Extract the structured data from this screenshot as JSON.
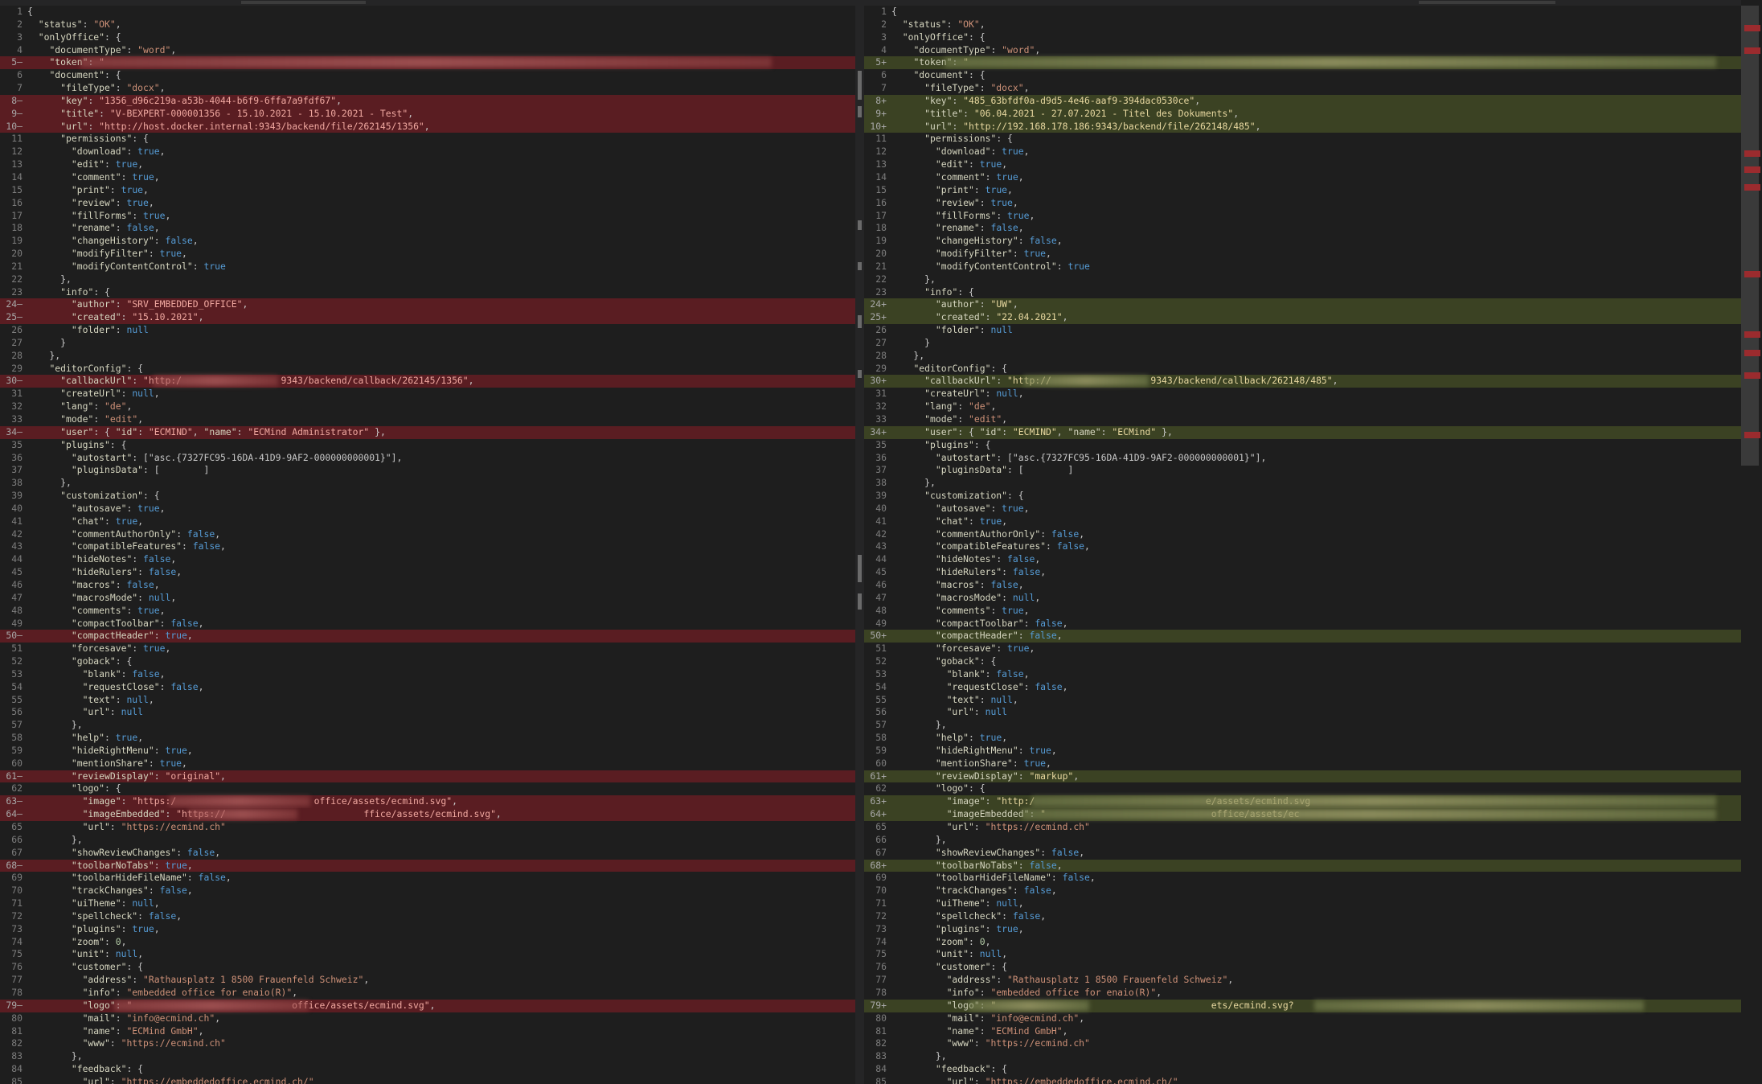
{
  "colors": {
    "removed_line": "#5a1d22",
    "added_line": "#3b4223",
    "string": "#ce9178",
    "keyword": "#569cd6",
    "number": "#b5cea8",
    "background": "#1e1e1e"
  },
  "left_lines": [
    {
      "n": "1",
      "t": "{"
    },
    {
      "n": "2",
      "t": "  \"status\": \"OK\","
    },
    {
      "n": "3",
      "t": "  \"onlyOffice\": {"
    },
    {
      "n": "4",
      "t": "    \"documentType\": \"word\","
    },
    {
      "n": "5—",
      "t": "    \"token\": \"",
      "c": true
    },
    {
      "n": "6",
      "t": "    \"document\": {"
    },
    {
      "n": "7",
      "t": "      \"fileType\": \"docx\","
    },
    {
      "n": "8—",
      "t": "      \"key\": \"1356_d96c219a-a53b-4044-b6f9-6ffa7a9fdf67\",",
      "c": true
    },
    {
      "n": "9—",
      "t": "      \"title\": \"V-BEXPERT-000001356 - 15.10.2021 - 15.10.2021 - Test\",",
      "c": true
    },
    {
      "n": "10—",
      "t": "      \"url\": \"http://host.docker.internal:9343/backend/file/262145/1356\",",
      "c": true
    },
    {
      "n": "11",
      "t": "      \"permissions\": {"
    },
    {
      "n": "12",
      "t": "        \"download\": true,"
    },
    {
      "n": "13",
      "t": "        \"edit\": true,"
    },
    {
      "n": "14",
      "t": "        \"comment\": true,"
    },
    {
      "n": "15",
      "t": "        \"print\": true,"
    },
    {
      "n": "16",
      "t": "        \"review\": true,"
    },
    {
      "n": "17",
      "t": "        \"fillForms\": true,"
    },
    {
      "n": "18",
      "t": "        \"rename\": false,"
    },
    {
      "n": "19",
      "t": "        \"changeHistory\": false,"
    },
    {
      "n": "20",
      "t": "        \"modifyFilter\": true,"
    },
    {
      "n": "21",
      "t": "        \"modifyContentControl\": true"
    },
    {
      "n": "22",
      "t": "      },"
    },
    {
      "n": "23",
      "t": "      \"info\": {"
    },
    {
      "n": "24—",
      "t": "        \"author\": \"SRV_EMBEDDED_OFFICE\",",
      "c": true
    },
    {
      "n": "25—",
      "t": "        \"created\": \"15.10.2021\",",
      "c": true
    },
    {
      "n": "26",
      "t": "        \"folder\": null"
    },
    {
      "n": "27",
      "t": "      }"
    },
    {
      "n": "28",
      "t": "    },"
    },
    {
      "n": "29",
      "t": "    \"editorConfig\": {"
    },
    {
      "n": "30—",
      "t": "      \"callbackUrl\": \"http:/                  9343/backend/callback/262145/1356\",",
      "c": true
    },
    {
      "n": "31",
      "t": "      \"createUrl\": null,"
    },
    {
      "n": "32",
      "t": "      \"lang\": \"de\","
    },
    {
      "n": "33",
      "t": "      \"mode\": \"edit\","
    },
    {
      "n": "34—",
      "t": "      \"user\": { \"id\": \"ECMIND\", \"name\": \"ECMind Administrator\" },",
      "c": true
    },
    {
      "n": "35",
      "t": "      \"plugins\": {"
    },
    {
      "n": "36",
      "t": "        \"autostart\": [\"asc.{7327FC95-16DA-41D9-9AF2-000000000001}\"],"
    },
    {
      "n": "37",
      "t": "        \"pluginsData\": [        ]"
    },
    {
      "n": "38",
      "t": "      },"
    },
    {
      "n": "39",
      "t": "      \"customization\": {"
    },
    {
      "n": "40",
      "t": "        \"autosave\": true,"
    },
    {
      "n": "41",
      "t": "        \"chat\": true,"
    },
    {
      "n": "42",
      "t": "        \"commentAuthorOnly\": false,"
    },
    {
      "n": "43",
      "t": "        \"compatibleFeatures\": false,"
    },
    {
      "n": "44",
      "t": "        \"hideNotes\": false,"
    },
    {
      "n": "45",
      "t": "        \"hideRulers\": false,"
    },
    {
      "n": "46",
      "t": "        \"macros\": false,"
    },
    {
      "n": "47",
      "t": "        \"macrosMode\": null,"
    },
    {
      "n": "48",
      "t": "        \"comments\": true,"
    },
    {
      "n": "49",
      "t": "        \"compactToolbar\": false,"
    },
    {
      "n": "50—",
      "t": "        \"compactHeader\": true,",
      "c": true
    },
    {
      "n": "51",
      "t": "        \"forcesave\": true,"
    },
    {
      "n": "52",
      "t": "        \"goback\": {"
    },
    {
      "n": "53",
      "t": "          \"blank\": false,"
    },
    {
      "n": "54",
      "t": "          \"requestClose\": false,"
    },
    {
      "n": "55",
      "t": "          \"text\": null,"
    },
    {
      "n": "56",
      "t": "          \"url\": null"
    },
    {
      "n": "57",
      "t": "        },"
    },
    {
      "n": "58",
      "t": "        \"help\": true,"
    },
    {
      "n": "59",
      "t": "        \"hideRightMenu\": true,"
    },
    {
      "n": "60",
      "t": "        \"mentionShare\": true,"
    },
    {
      "n": "61—",
      "t": "        \"reviewDisplay\": \"original\",",
      "c": true
    },
    {
      "n": "62",
      "t": "        \"logo\": {"
    },
    {
      "n": "63—",
      "t": "          \"image\": \"https:/                         office/assets/ecmind.svg\",",
      "c": true
    },
    {
      "n": "64—",
      "t": "          \"imageEmbedded\": \"https://                         ffice/assets/ecmind.svg\",",
      "c": true
    },
    {
      "n": "65",
      "t": "          \"url\": \"https://ecmind.ch\""
    },
    {
      "n": "66",
      "t": "        },"
    },
    {
      "n": "67",
      "t": "        \"showReviewChanges\": false,"
    },
    {
      "n": "68—",
      "t": "        \"toolbarNoTabs\": true,",
      "c": true
    },
    {
      "n": "69",
      "t": "        \"toolbarHideFileName\": false,"
    },
    {
      "n": "70",
      "t": "        \"trackChanges\": false,"
    },
    {
      "n": "71",
      "t": "        \"uiTheme\": null,"
    },
    {
      "n": "72",
      "t": "        \"spellcheck\": false,"
    },
    {
      "n": "73",
      "t": "        \"plugins\": true,"
    },
    {
      "n": "74",
      "t": "        \"zoom\": 0,"
    },
    {
      "n": "75",
      "t": "        \"unit\": null,"
    },
    {
      "n": "76",
      "t": "        \"customer\": {"
    },
    {
      "n": "77",
      "t": "          \"address\": \"Rathausplatz 1 8500 Frauenfeld Schweiz\","
    },
    {
      "n": "78",
      "t": "          \"info\": \"embedded office for enaio(R)\","
    },
    {
      "n": "79—",
      "t": "          \"logo\": \"                             office/assets/ecmind.svg\",",
      "c": true
    },
    {
      "n": "80",
      "t": "          \"mail\": \"info@ecmind.ch\","
    },
    {
      "n": "81",
      "t": "          \"name\": \"ECMind GmbH\","
    },
    {
      "n": "82",
      "t": "          \"www\": \"https://ecmind.ch\""
    },
    {
      "n": "83",
      "t": "        },"
    },
    {
      "n": "84",
      "t": "        \"feedback\": {"
    },
    {
      "n": "85",
      "t": "          \"url\": \"https://embeddedoffice.ecmind.ch/\""
    }
  ],
  "right_lines": [
    {
      "n": "1",
      "t": "{"
    },
    {
      "n": "2",
      "t": "  \"status\": \"OK\","
    },
    {
      "n": "3",
      "t": "  \"onlyOffice\": {"
    },
    {
      "n": "4",
      "t": "    \"documentType\": \"word\","
    },
    {
      "n": "5+",
      "t": "    \"token\": \"",
      "c": true
    },
    {
      "n": "6",
      "t": "    \"document\": {"
    },
    {
      "n": "7",
      "t": "      \"fileType\": \"docx\","
    },
    {
      "n": "8+",
      "t": "      \"key\": \"485_63bfdf0a-d9d5-4e46-aaf9-394dac0530ce\",",
      "c": true
    },
    {
      "n": "9+",
      "t": "      \"title\": \"06.04.2021 - 27.07.2021 - Titel des Dokuments\",",
      "c": true
    },
    {
      "n": "10+",
      "t": "      \"url\": \"http://192.168.178.186:9343/backend/file/262148/485\",",
      "c": true
    },
    {
      "n": "11",
      "t": "      \"permissions\": {"
    },
    {
      "n": "12",
      "t": "        \"download\": true,"
    },
    {
      "n": "13",
      "t": "        \"edit\": true,"
    },
    {
      "n": "14",
      "t": "        \"comment\": true,"
    },
    {
      "n": "15",
      "t": "        \"print\": true,"
    },
    {
      "n": "16",
      "t": "        \"review\": true,"
    },
    {
      "n": "17",
      "t": "        \"fillForms\": true,"
    },
    {
      "n": "18",
      "t": "        \"rename\": false,"
    },
    {
      "n": "19",
      "t": "        \"changeHistory\": false,"
    },
    {
      "n": "20",
      "t": "        \"modifyFilter\": true,"
    },
    {
      "n": "21",
      "t": "        \"modifyContentControl\": true"
    },
    {
      "n": "22",
      "t": "      },"
    },
    {
      "n": "23",
      "t": "      \"info\": {"
    },
    {
      "n": "24+",
      "t": "        \"author\": \"UW\",",
      "c": true
    },
    {
      "n": "25+",
      "t": "        \"created\": \"22.04.2021\",",
      "c": true
    },
    {
      "n": "26",
      "t": "        \"folder\": null"
    },
    {
      "n": "27",
      "t": "      }"
    },
    {
      "n": "28",
      "t": "    },"
    },
    {
      "n": "29",
      "t": "    \"editorConfig\": {"
    },
    {
      "n": "30+",
      "t": "      \"callbackUrl\": \"http://                  9343/backend/callback/262148/485\",",
      "c": true
    },
    {
      "n": "31",
      "t": "      \"createUrl\": null,"
    },
    {
      "n": "32",
      "t": "      \"lang\": \"de\","
    },
    {
      "n": "33",
      "t": "      \"mode\": \"edit\","
    },
    {
      "n": "34+",
      "t": "      \"user\": { \"id\": \"ECMIND\", \"name\": \"ECMind\" },",
      "c": true
    },
    {
      "n": "35",
      "t": "      \"plugins\": {"
    },
    {
      "n": "36",
      "t": "        \"autostart\": [\"asc.{7327FC95-16DA-41D9-9AF2-000000000001}\"],"
    },
    {
      "n": "37",
      "t": "        \"pluginsData\": [        ]"
    },
    {
      "n": "38",
      "t": "      },"
    },
    {
      "n": "39",
      "t": "      \"customization\": {"
    },
    {
      "n": "40",
      "t": "        \"autosave\": true,"
    },
    {
      "n": "41",
      "t": "        \"chat\": true,"
    },
    {
      "n": "42",
      "t": "        \"commentAuthorOnly\": false,"
    },
    {
      "n": "43",
      "t": "        \"compatibleFeatures\": false,"
    },
    {
      "n": "44",
      "t": "        \"hideNotes\": false,"
    },
    {
      "n": "45",
      "t": "        \"hideRulers\": false,"
    },
    {
      "n": "46",
      "t": "        \"macros\": false,"
    },
    {
      "n": "47",
      "t": "        \"macrosMode\": null,"
    },
    {
      "n": "48",
      "t": "        \"comments\": true,"
    },
    {
      "n": "49",
      "t": "        \"compactToolbar\": false,"
    },
    {
      "n": "50+",
      "t": "        \"compactHeader\": false,",
      "c": true
    },
    {
      "n": "51",
      "t": "        \"forcesave\": true,"
    },
    {
      "n": "52",
      "t": "        \"goback\": {"
    },
    {
      "n": "53",
      "t": "          \"blank\": false,"
    },
    {
      "n": "54",
      "t": "          \"requestClose\": false,"
    },
    {
      "n": "55",
      "t": "          \"text\": null,"
    },
    {
      "n": "56",
      "t": "          \"url\": null"
    },
    {
      "n": "57",
      "t": "        },"
    },
    {
      "n": "58",
      "t": "        \"help\": true,"
    },
    {
      "n": "59",
      "t": "        \"hideRightMenu\": true,"
    },
    {
      "n": "60",
      "t": "        \"mentionShare\": true,"
    },
    {
      "n": "61+",
      "t": "        \"reviewDisplay\": \"markup\",",
      "c": true
    },
    {
      "n": "62",
      "t": "        \"logo\": {"
    },
    {
      "n": "63+",
      "t": "          \"image\": \"http:/                               e/assets/ecmind.svg",
      "c": true
    },
    {
      "n": "64+",
      "t": "          \"imageEmbedded\": \"                              office/assets/ec",
      "c": true
    },
    {
      "n": "65",
      "t": "          \"url\": \"https://ecmind.ch\""
    },
    {
      "n": "66",
      "t": "        },"
    },
    {
      "n": "67",
      "t": "        \"showReviewChanges\": false,"
    },
    {
      "n": "68+",
      "t": "        \"toolbarNoTabs\": false,",
      "c": true
    },
    {
      "n": "69",
      "t": "        \"toolbarHideFileName\": false,"
    },
    {
      "n": "70",
      "t": "        \"trackChanges\": false,"
    },
    {
      "n": "71",
      "t": "        \"uiTheme\": null,"
    },
    {
      "n": "72",
      "t": "        \"spellcheck\": false,"
    },
    {
      "n": "73",
      "t": "        \"plugins\": true,"
    },
    {
      "n": "74",
      "t": "        \"zoom\": 0,"
    },
    {
      "n": "75",
      "t": "        \"unit\": null,"
    },
    {
      "n": "76",
      "t": "        \"customer\": {"
    },
    {
      "n": "77",
      "t": "          \"address\": \"Rathausplatz 1 8500 Frauenfeld Schweiz\","
    },
    {
      "n": "78",
      "t": "          \"info\": \"embedded office for enaio(R)\","
    },
    {
      "n": "79+",
      "t": "          \"logo\": \"                                       ets/ecmind.svg?",
      "c": true
    },
    {
      "n": "80",
      "t": "          \"mail\": \"info@ecmind.ch\","
    },
    {
      "n": "81",
      "t": "          \"name\": \"ECMind GmbH\","
    },
    {
      "n": "82",
      "t": "          \"www\": \"https://ecmind.ch\""
    },
    {
      "n": "83",
      "t": "        },"
    },
    {
      "n": "84",
      "t": "        \"feedback\": {"
    },
    {
      "n": "85",
      "t": "          \"url\": \"https://embeddedoffice.ecmind.ch/\""
    }
  ]
}
